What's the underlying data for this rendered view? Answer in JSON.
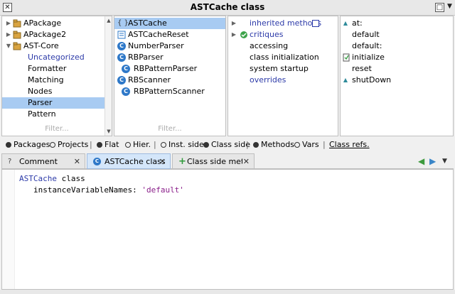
{
  "window": {
    "title": "ASTCache class",
    "close_glyph": "✕",
    "max_glyph": "□",
    "menu_glyph": "▼"
  },
  "packages": {
    "items": [
      {
        "label": "APackage",
        "expand": "▶"
      },
      {
        "label": "APackage2",
        "expand": "▶"
      },
      {
        "label": "AST-Core",
        "expand": "▼"
      },
      {
        "label": "Uncategorized",
        "blue": true
      },
      {
        "label": "Formatter"
      },
      {
        "label": "Matching"
      },
      {
        "label": "Nodes"
      },
      {
        "label": "Parser",
        "selected": true
      },
      {
        "label": "Pattern"
      }
    ],
    "filter": "Filter..."
  },
  "classes": {
    "items": [
      {
        "label": "ASTCache",
        "icon": "braces-icon",
        "selected": true
      },
      {
        "label": "ASTCacheReset",
        "icon": "class-doc-icon"
      },
      {
        "label": "NumberParser",
        "icon": "class-icon"
      },
      {
        "label": "RBParser",
        "icon": "class-icon"
      },
      {
        "label": "RBPatternParser",
        "icon": "class-icon"
      },
      {
        "label": "RBScanner",
        "icon": "class-icon"
      },
      {
        "label": "RBPatternScanner",
        "icon": "class-icon"
      }
    ],
    "filter": "Filter..."
  },
  "protocols": {
    "items": [
      {
        "label": "inherited methods",
        "blue": true,
        "expand": "▶",
        "checkbox": true
      },
      {
        "label": "critiques",
        "blue": true,
        "expand": "▶",
        "icon": "critique-icon"
      },
      {
        "label": "accessing"
      },
      {
        "label": "class initialization"
      },
      {
        "label": "system startup"
      },
      {
        "label": "overrides",
        "blue": true
      }
    ]
  },
  "methods": {
    "items": [
      {
        "label": "at:",
        "icon": "up-arrow-icon"
      },
      {
        "label": "default"
      },
      {
        "label": "default:"
      },
      {
        "label": "initialize",
        "icon": "doc-flag-icon"
      },
      {
        "label": "reset"
      },
      {
        "label": "shutDown",
        "icon": "up-arrow-icon"
      }
    ]
  },
  "toolbar": {
    "packages": "Packages",
    "projects": "Projects",
    "flat": "Flat",
    "hier": "Hier.",
    "inst_side": "Inst. side",
    "class_side": "Class side",
    "methods_opt": "Methods",
    "vars": "Vars",
    "class_refs": "Class refs.",
    "sep": "|"
  },
  "tabs": [
    {
      "label": "Comment",
      "icon": "help-icon",
      "close": "✕"
    },
    {
      "label": "ASTCache class",
      "icon": "class-icon",
      "close": "✕",
      "active": true
    },
    {
      "label": "Class side method",
      "icon": "add-icon",
      "close": "✕"
    }
  ],
  "nav": {
    "back": "◀",
    "forward": "▶",
    "menu": "▼"
  },
  "editor": {
    "line1_kw": "ASTCache",
    "line1_rest": " class",
    "line2_kw": "instanceVariableNames:",
    "line2_str": "'default'"
  },
  "colors": {
    "selection": "#a8cbf2",
    "link": "#2c3aa8",
    "string": "#8a1f8a",
    "class_icon": "#2e78c8"
  }
}
